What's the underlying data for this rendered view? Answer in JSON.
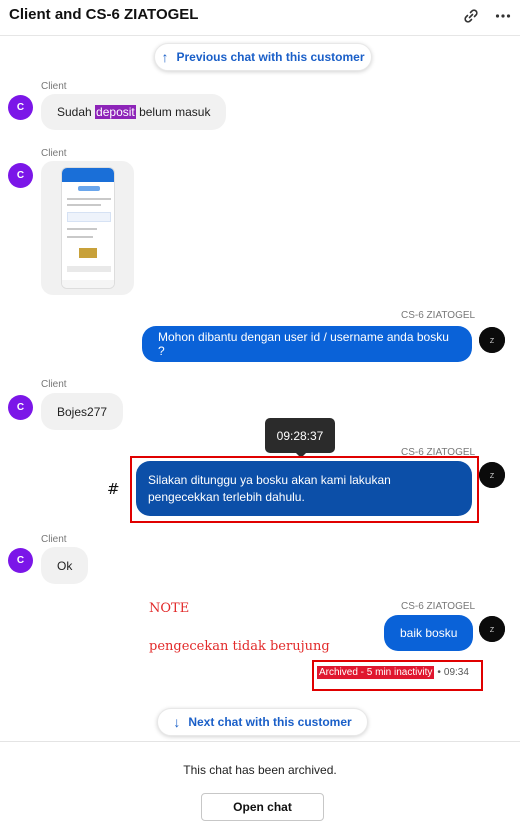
{
  "header": {
    "title": "Client and CS-6 ZIATOGEL",
    "link_icon": "link-icon",
    "more_icon": "more-horizontal-icon"
  },
  "nav": {
    "previous_label": "Previous chat with this customer",
    "next_label": "Next chat with this customer",
    "up_arrow": "↑",
    "down_arrow": "↓"
  },
  "avatar_letter": "C",
  "messages": {
    "m1": {
      "sender": "Client",
      "text_before": "Sudah ",
      "text_highlight": "deposit",
      "text_after": " belum masuk"
    },
    "m2": {
      "sender": "Client"
    },
    "m3": {
      "sender": "CS-6 ZIATOGEL",
      "text": "Mohon dibantu dengan user id / username anda bosku ?"
    },
    "m4": {
      "sender": "Client",
      "text": "Bojes277"
    },
    "m5": {
      "sender": "CS-6 ZIATOGEL",
      "line1": "Silakan ditunggu ya bosku akan kami lakukan",
      "line2": "pengecekkan terlebih dahulu."
    },
    "m6": {
      "sender": "Client",
      "text": "Ok"
    },
    "m7": {
      "sender": "CS-6 ZIATOGEL",
      "text": "baik bosku"
    }
  },
  "tooltip_time": "09:28:37",
  "hash_mark": "#",
  "annotations": {
    "note_title": "NOTE",
    "note_text": "pengecekan tidak berujung"
  },
  "status": {
    "archived": "Archived - 5 min inactivity",
    "separator": "•",
    "time": "09:34"
  },
  "footer": {
    "archived_text": "This chat has been archived.",
    "open_button": "Open chat"
  },
  "colors": {
    "accent_blue": "#0a62d8",
    "avatar_purple": "#7b16e8",
    "highlight_purple": "#8d24b8",
    "annotation_red": "#e00000",
    "archived_red": "#e0172f"
  }
}
